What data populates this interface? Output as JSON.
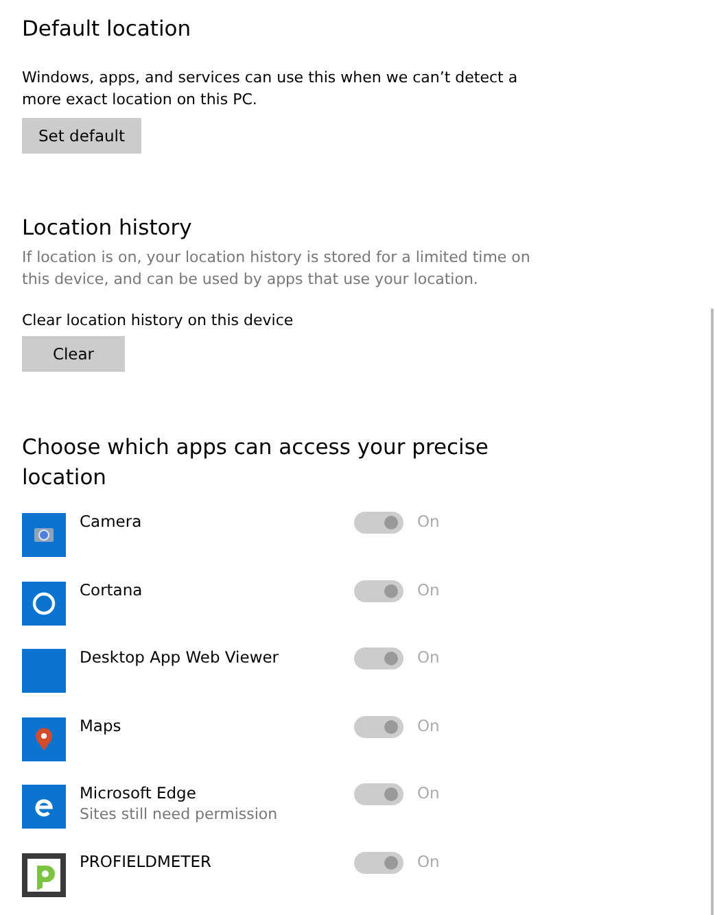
{
  "default_location": {
    "heading": "Default location",
    "description": "Windows, apps, and services can use this when we can’t detect a more exact location on this PC.",
    "button": "Set default"
  },
  "location_history": {
    "heading": "Location history",
    "description": "If location is on, your location history is stored for a limited time on this device, and can be used by apps that use your location.",
    "clear_label": "Clear location history on this device",
    "button": "Clear"
  },
  "apps_section": {
    "heading": "Choose which apps can access your precise location",
    "apps": [
      {
        "name": "Camera",
        "kind": "camera",
        "on": true,
        "disabled": true,
        "state_label": "On"
      },
      {
        "name": "Cortana",
        "kind": "ring",
        "on": true,
        "disabled": true,
        "state_label": "On"
      },
      {
        "name": "Desktop App Web Viewer",
        "kind": "blank",
        "on": true,
        "disabled": true,
        "state_label": "On"
      },
      {
        "name": "Maps",
        "kind": "pin",
        "on": true,
        "disabled": true,
        "state_label": "On"
      },
      {
        "name": "Microsoft Edge",
        "subtitle": "Sites still need permission",
        "kind": "edge",
        "on": true,
        "disabled": true,
        "state_label": "On"
      },
      {
        "name": "PROFIELDMETER",
        "kind": "meter",
        "on": true,
        "disabled": true,
        "state_label": "On"
      }
    ]
  }
}
